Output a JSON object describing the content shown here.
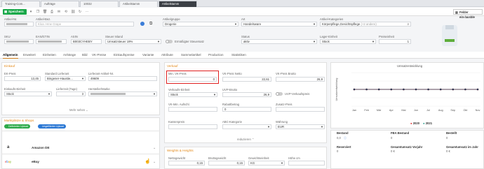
{
  "tabs": [
    "Training-Com...",
    "Aufträge",
    "10032",
    "Artikelstamm",
    "Artikelstamm"
  ],
  "toolbar": {
    "save_label": "Speichern",
    "felder_label": "Felder ein-/ausble"
  },
  "row1": {
    "artnr_label": "Artikel-Nr.",
    "artbez_label": "Artikel-Bez.",
    "artbez_value": "Kloa. Hme Grape",
    "gruppe_label": "Artikelgruppe",
    "gruppe_value": "Drogerie",
    "art_label": "Art",
    "art_value": "Handelsware",
    "kat_label": "Artikel-Kategorien",
    "kat_value": "Körperpflege,Gesichtspflege",
    "kat_more": "(+2 andere)"
  },
  "row2": {
    "sku_label": "SKU",
    "ean_label": "EAN/GTIN",
    "asin_label": "ASIN",
    "asin_value": "B003CYHEBY",
    "steuer_label": "Steuer Inland",
    "steuer_value": "Umsatzsteuer 19%",
    "ermaessigt_label": "Ermäßigter Steuersatz",
    "status_label": "Status",
    "status_value": "aktiv",
    "lager_label": "Lager-Einheit",
    "lager_value": "Stück",
    "preis_label": "Preiseinheit",
    "preis_value": "1"
  },
  "navtabs": [
    "Allgemein",
    "Erweitert",
    "Einheiten",
    "Anhänge",
    "Bild",
    "VK-Preise",
    "Einkaufspreise",
    "Variante",
    "Attribute",
    "Sammelartikel",
    "Production",
    "Statistiken"
  ],
  "einkauf": {
    "title": "Einkauf",
    "ek_label": "EK-Preis",
    "ek_value": "13,45",
    "lief_label": "Standard Lieferant",
    "lief_value": "Bingener-Haustie...",
    "lnr_label": "Lieferant-Artikel-Nr.",
    "lnr_value": "49609",
    "eke_label": "Einkaufs-Einheit",
    "eke_value": "Stück",
    "lt_label": "Lieferzeit (Tage)",
    "lt_value": "3",
    "marke_label": "Hersteller/Marke",
    "mehr": "Mehr sehen"
  },
  "marketplaces": {
    "title": "Marktplätze & Shops",
    "badge1": "Definierter Upload",
    "badge2": "Ungefilterter Upload",
    "amazon": "Amazon DE",
    "ebay": "eBay"
  },
  "verkauf": {
    "title": "Verkauf",
    "minvk_label": "Min. VK-Preis",
    "minvk_value": "0",
    "netto_label": "VK-Preis Netto",
    "netto_value": "22,61",
    "brutto_label": "VK-Preis Brutto",
    "brutto_value": "26,9",
    "vke_label": "Verkaufs-Einheit",
    "vke_value": "Stück",
    "uvp_label": "UVP-Brutto",
    "uvp_value": "26,9",
    "uvpv_label": "UVP-Verkaufspreis",
    "auf_label": "VK-Min. Aufschl.",
    "rabatt_label": "Rabattbetrag",
    "rabatt_value": "0",
    "zus_label": "Zusatz-Preis",
    "kasse_label": "Kassenpreis",
    "abc_label": "ABC-Kategorie",
    "waehrung_label": "Währung",
    "waehrung_value": "EUR",
    "reduzieren": "reduzieren"
  },
  "weights": {
    "title": "Weights & Heights",
    "netto_label": "Nettogewicht",
    "netto_value": "0,15",
    "brutto_label": "Bruttogewicht",
    "brutto_value": "0,15",
    "einheit_label": "Gewichtseinheit",
    "einheit_value": "KG",
    "hoehe_label": "Höhe cm"
  },
  "chart_data": {
    "type": "line",
    "title": "Umsatzentwicklung",
    "ylabel": "Umsatzentwicklung",
    "categories": [
      "Jan",
      "Feb",
      "Mär",
      "Apr",
      "Mai",
      "Jun",
      "Jul",
      "Aug",
      "Sep",
      "Okt",
      "Nov"
    ],
    "series": [
      {
        "name": "2020",
        "color": "#e03030",
        "values": [
          0,
          0,
          0,
          0,
          0,
          0,
          0,
          0,
          0,
          0,
          0
        ]
      },
      {
        "name": "2021",
        "color": "#2a9d8f",
        "values": [
          0,
          0,
          0,
          0,
          0,
          0,
          0,
          0,
          0,
          0,
          0
        ]
      }
    ]
  },
  "stats": {
    "bestand_label": "Bestand",
    "bestand_value": "0,0",
    "fba_label": "FBA Bestand",
    "fba_value": "0",
    "bestellt_label": "Bestellt",
    "bestellt_value": "0",
    "reserviert_label": "Reserviert",
    "reserviert_value": "0",
    "gv_label": "Gesamtumsatz Vorjahr",
    "gv_value": "0 €",
    "gj_label": "Gesamtumsatz im Jahr",
    "gj_value": "0 €"
  }
}
